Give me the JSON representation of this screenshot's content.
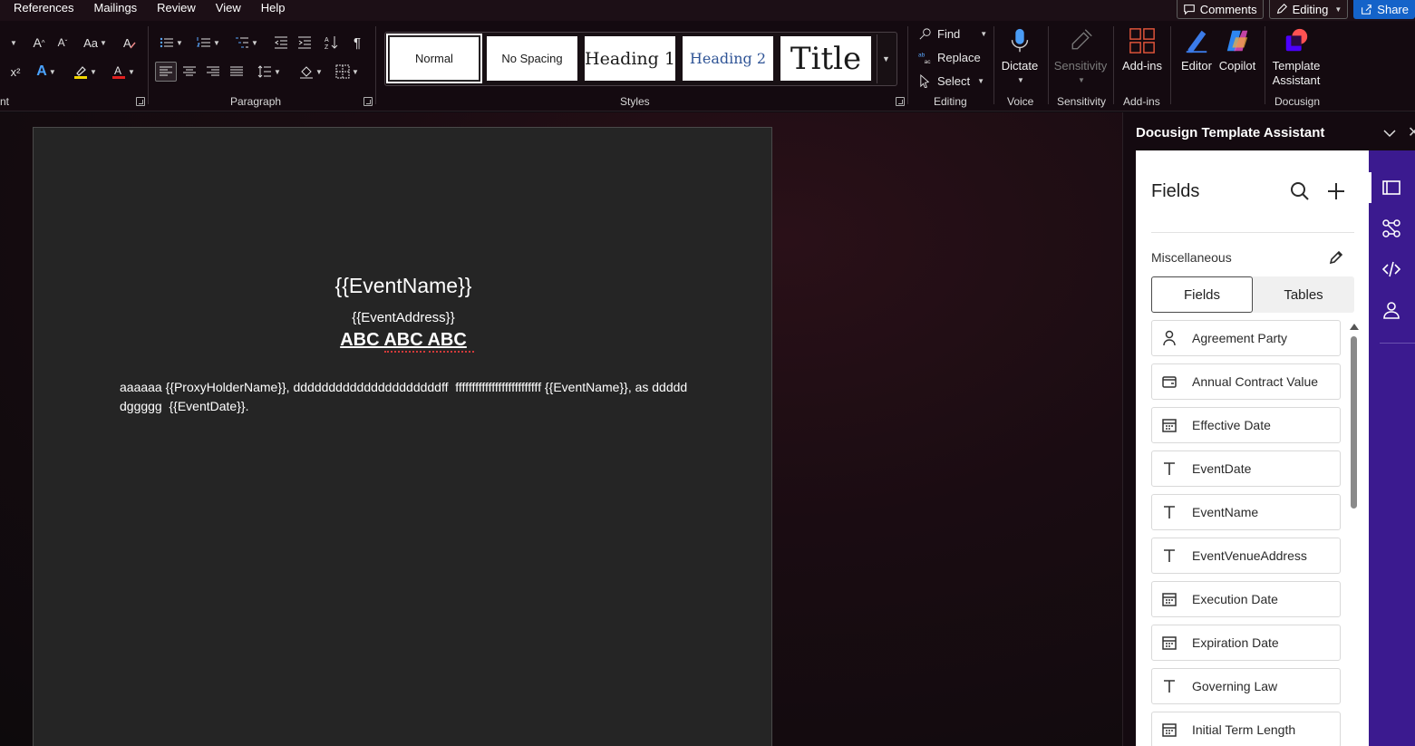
{
  "menubar": {
    "tabs": [
      "References",
      "Mailings",
      "Review",
      "View",
      "Help"
    ],
    "comments_label": "Comments",
    "editing_label": "Editing",
    "share_label": "Share"
  },
  "ribbon": {
    "font_group_label": "nt",
    "paragraph_group_label": "Paragraph",
    "styles_group_label": "Styles",
    "editing_group_label": "Editing",
    "voice_group_label": "Voice",
    "sensitivity_group_label": "Sensitivity",
    "addins_group_label": "Add-ins",
    "docusign_group_label": "Docusign",
    "styles": [
      "Normal",
      "No Spacing",
      "Heading 1",
      "Heading 2",
      "Title"
    ],
    "find_label": "Find",
    "replace_label": "Replace",
    "select_label": "Select",
    "dictate_label": "Dictate",
    "sensitivity_label": "Sensitivity",
    "addins_label": "Add-ins",
    "editor_label": "Editor",
    "copilot_label": "Copilot",
    "template_assistant_label_1": "Template",
    "template_assistant_label_2": "Assistant",
    "font_size_label": "Aa",
    "superscript_label": "x²",
    "pilcrow": "¶",
    "highlight_color": "#f2d600",
    "font_color": "#e02020"
  },
  "document": {
    "title": "{{EventName}}",
    "address": "{{EventAddress}}",
    "heading": "ABC ABC ABC",
    "paragraph": "aaaaaa {{ProxyHolderName}}, dddddddddddddddddddddff  ffffffffffffffffffffffffff {{EventName}}, as ddddd   dggggg  {{EventDate}}."
  },
  "pane": {
    "title": "Docusign Template Assistant",
    "fields_title": "Fields",
    "category": "Miscellaneous",
    "tab_fields": "Fields",
    "tab_tables": "Tables",
    "fields": [
      {
        "label": "Agreement Party",
        "icon": "person-icon"
      },
      {
        "label": "Annual Contract Value",
        "icon": "wallet-icon"
      },
      {
        "label": "Effective Date",
        "icon": "calendar-icon"
      },
      {
        "label": "EventDate",
        "icon": "text-icon"
      },
      {
        "label": "EventName",
        "icon": "text-icon"
      },
      {
        "label": "EventVenueAddress",
        "icon": "text-icon"
      },
      {
        "label": "Execution Date",
        "icon": "calendar-icon"
      },
      {
        "label": "Expiration Date",
        "icon": "calendar-icon"
      },
      {
        "label": "Governing Law",
        "icon": "text-icon"
      },
      {
        "label": "Initial Term Length",
        "icon": "calendar-icon"
      }
    ],
    "accent_color": "#3b1a8f"
  }
}
